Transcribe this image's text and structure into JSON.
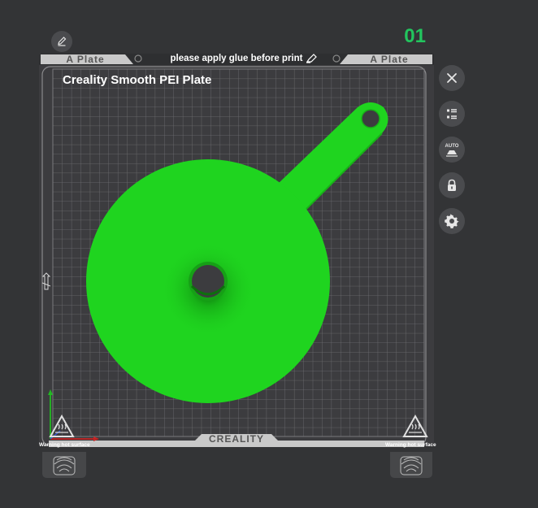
{
  "plate": {
    "number": "01",
    "tab_left": "A Plate",
    "tab_right": "A Plate",
    "notice": "please apply glue before print",
    "title": "Creality Smooth PEI Plate",
    "brand": "CREALITY",
    "warning_left": "Warning hot surface",
    "warning_right": "Warning hot surface"
  },
  "colors": {
    "background": "#333436",
    "plate_surface": "#3c3c3f",
    "grid": "#6f6f72",
    "frame": "#c9c9c9",
    "model": "#1fd41f",
    "plate_number": "#22c55e"
  },
  "icons": {
    "close": "close-icon",
    "list": "list-icon",
    "auto_arrange": "auto-arrange-icon",
    "lock": "lock-icon",
    "settings": "gear-icon",
    "edit": "pencil-icon",
    "fingerprint": "fingerprint-icon",
    "hot_surface": "hot-surface-warning-icon"
  }
}
